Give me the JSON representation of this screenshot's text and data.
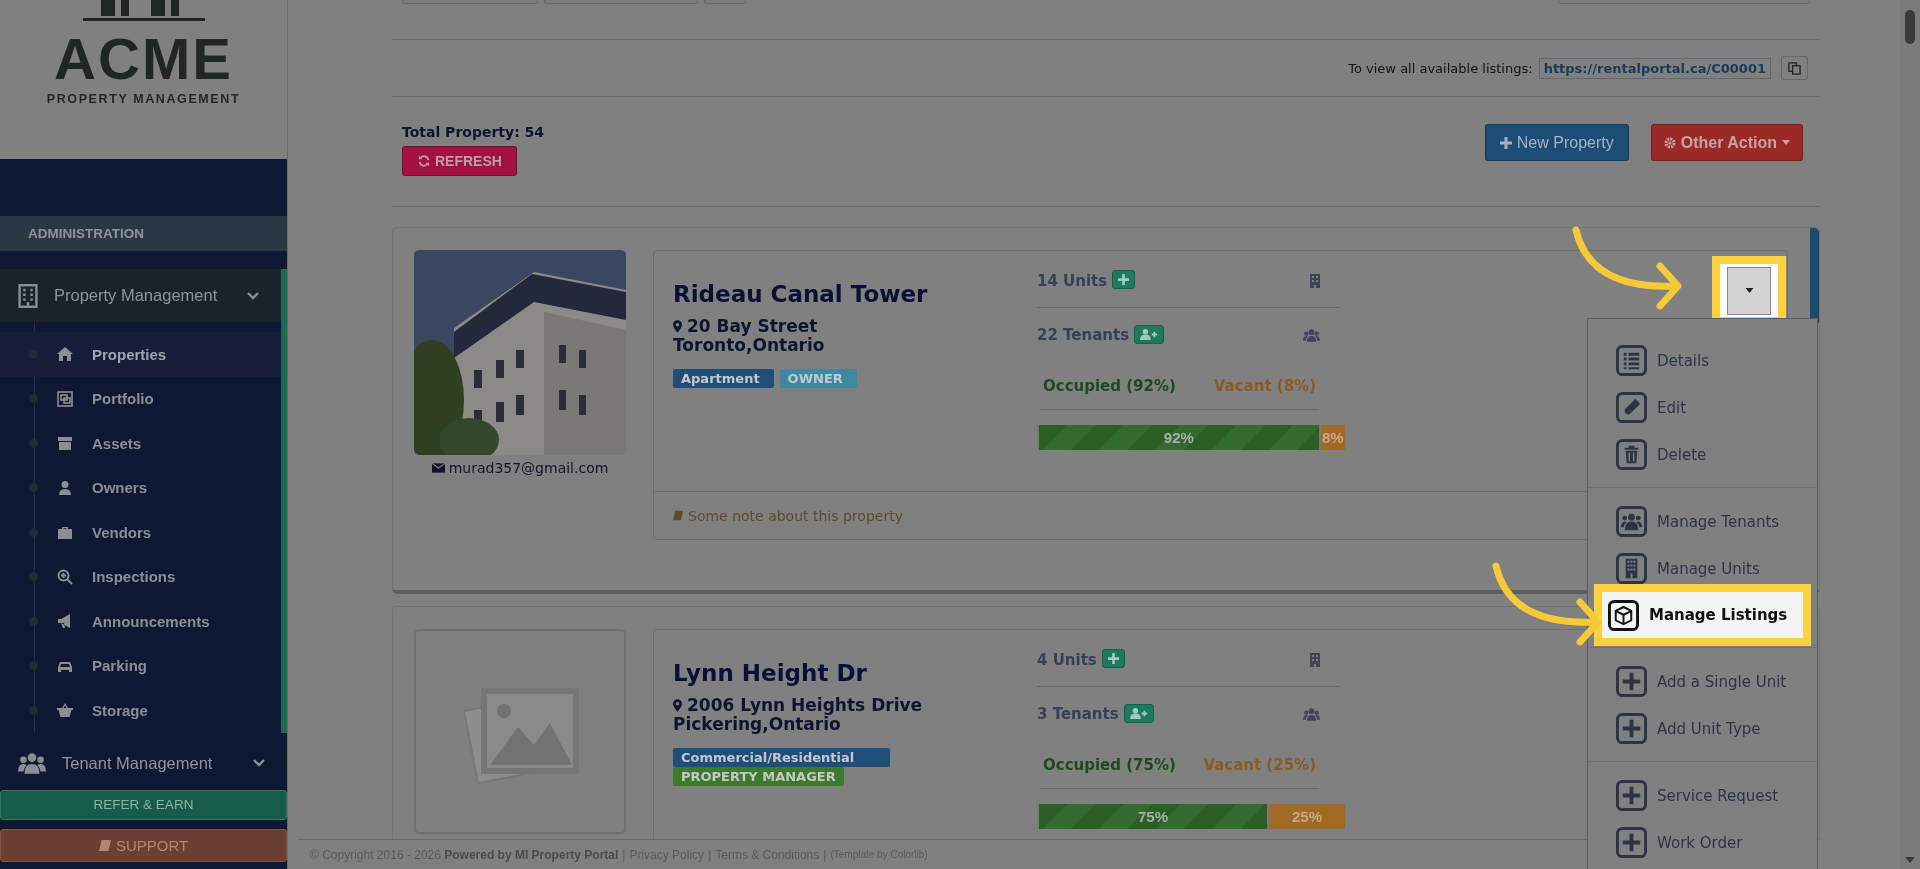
{
  "brand": {
    "name": "ACME",
    "tagline": "PROPERTY MANAGEMENT"
  },
  "sidebar": {
    "section": "ADMINISTRATION",
    "groups": [
      {
        "label": "Property Management",
        "expanded": true,
        "children": [
          {
            "label": "Properties",
            "selected": true
          },
          {
            "label": "Portfolio",
            "selected": false
          },
          {
            "label": "Assets",
            "selected": false
          },
          {
            "label": "Owners",
            "selected": false
          },
          {
            "label": "Vendors",
            "selected": false
          },
          {
            "label": "Inspections",
            "selected": false
          },
          {
            "label": "Announcements",
            "selected": false
          },
          {
            "label": "Parking",
            "selected": false
          },
          {
            "label": "Storage",
            "selected": false
          }
        ]
      },
      {
        "label": "Tenant Management",
        "expanded": false
      }
    ],
    "buttons": [
      {
        "label": "REFER & EARN",
        "kind": "refer"
      },
      {
        "label": "SUPPORT",
        "kind": "support"
      }
    ]
  },
  "listing_link": {
    "label": "To view all available listings:",
    "url": "https://rentalportal.ca/C00001"
  },
  "total": "Total Property: 54",
  "actions": [
    {
      "label": "REFRESH",
      "kind": "refresh"
    },
    {
      "label": "New Property",
      "kind": "new"
    },
    {
      "label": "Other Action",
      "kind": "other"
    }
  ],
  "properties": [
    {
      "name": "Rideau Canal Tower",
      "address": "20 Bay Street",
      "city": "Toronto,Ontario",
      "email": "murad357@gmail.com",
      "tags": [
        {
          "label": "Apartment",
          "color": "#1f4e79"
        },
        {
          "label": "OWNER",
          "color": "#3c8a9f"
        }
      ],
      "units": "14 Units",
      "tenants": "22 Tenants",
      "occupied": "Occupied (92%)",
      "vacant": "Vacant (8%)",
      "bar": [
        {
          "label": "92%",
          "kind": "occupied",
          "level": 0.92
        },
        {
          "label": "8%",
          "kind": "vacant",
          "level": 0.08
        }
      ],
      "note": "Some note about this property",
      "menu_open": true
    },
    {
      "name": "Lynn Height Dr",
      "address": "2006 Lynn Heights Drive",
      "city": "Pickering,Ontario",
      "tags": [
        {
          "label": "Commercial/Residential",
          "color": "#1f4e79"
        },
        {
          "label": "PROPERTY MANAGER",
          "color": "#3d7a2a"
        }
      ],
      "units": "4 Units",
      "tenants": "3 Tenants",
      "occupied": "Occupied (75%)",
      "vacant": "Vacant (25%)",
      "bar": [
        {
          "label": "75%",
          "kind": "occupied",
          "level": 0.75
        },
        {
          "label": "25%",
          "kind": "vacant",
          "level": 0.25
        }
      ],
      "menu_open": false
    }
  ],
  "menu": {
    "toggle_highlighted": true,
    "groups": [
      [
        {
          "label": "Details",
          "highlighted": false
        },
        {
          "label": "Edit",
          "highlighted": false
        },
        {
          "label": "Delete",
          "highlighted": false
        }
      ],
      [
        {
          "label": "Manage Tenants",
          "highlighted": false
        },
        {
          "label": "Manage Units",
          "highlighted": false
        },
        {
          "label": "Manage Listings",
          "highlighted": true
        }
      ],
      [
        {
          "label": "Add a Single Unit",
          "highlighted": false
        },
        {
          "label": "Add Unit Type",
          "highlighted": false
        }
      ],
      [
        {
          "label": "Service Request",
          "highlighted": false
        },
        {
          "label": "Work Order",
          "highlighted": false
        }
      ]
    ]
  },
  "footer": {
    "text": "© Copyright 2016 - 2026 **Powered by MI Property Portal**",
    "separator": "|",
    "links": [
      "Privacy Policy",
      "Terms & Conditions"
    ],
    "credit": "(Template by Colorlib)"
  }
}
